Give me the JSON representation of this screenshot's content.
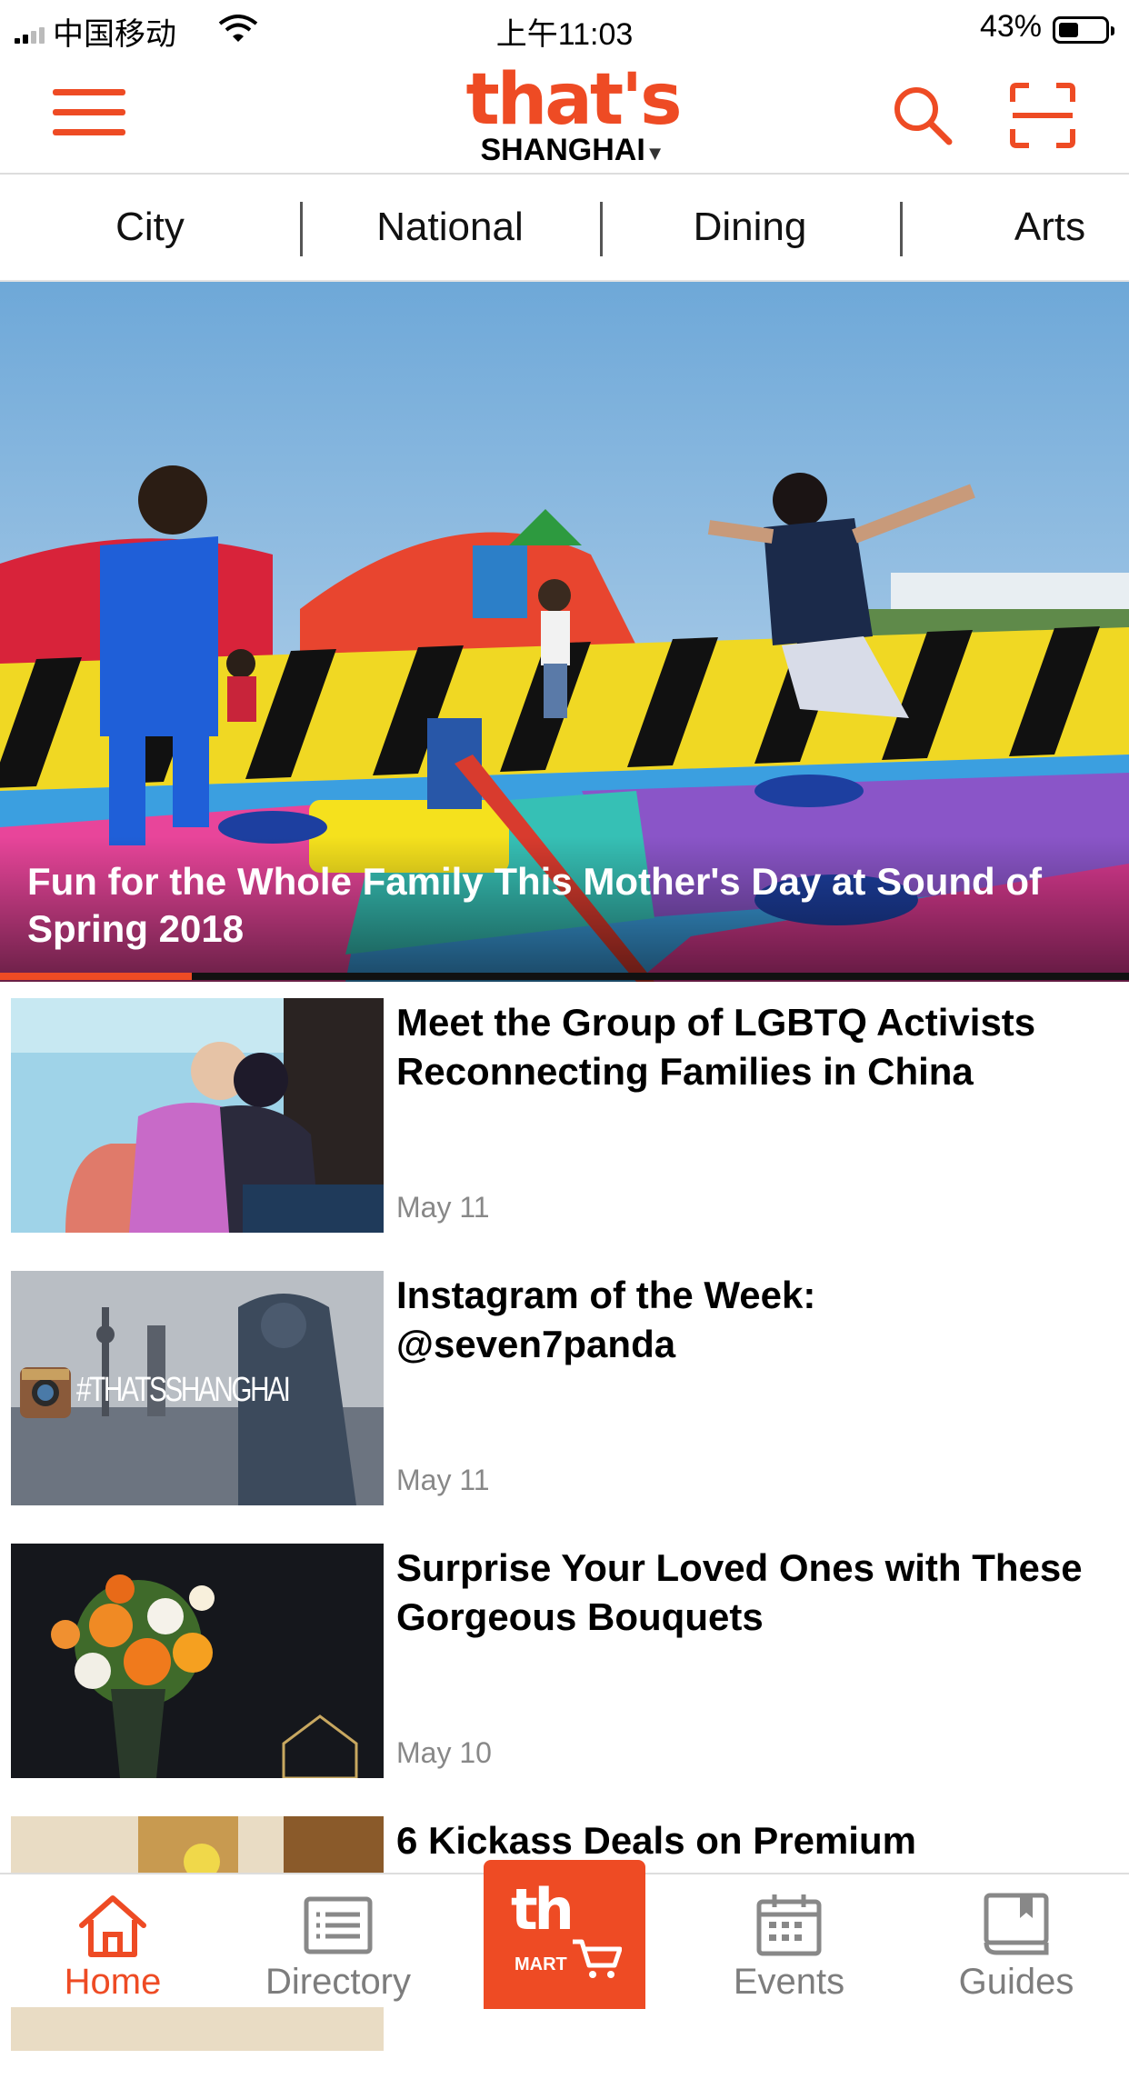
{
  "status_bar": {
    "carrier": "中国移动",
    "time": "上午11:03",
    "battery": "43%",
    "battery_level": 0.43
  },
  "header": {
    "brand": "that's",
    "city": "SHANGHAI"
  },
  "tabs": [
    "City",
    "National",
    "Dining",
    "Arts"
  ],
  "hero": {
    "title": "Fun for the Whole Family This Mother's Day at Sound of Spring 2018",
    "progress": 0.17
  },
  "articles": [
    {
      "title": "Meet the Group of LGBTQ Activists Reconnecting Families in China",
      "date": "May 11"
    },
    {
      "title": "Instagram of the Week: @seven7panda",
      "date": "May 11",
      "thumb_text": "#THATSSHANGHAI"
    },
    {
      "title": "Surprise Your Loved Ones with These Gorgeous Bouquets",
      "date": "May 10"
    },
    {
      "title": "6 Kickass Deals on Premium",
      "date": ""
    }
  ],
  "bottom_nav": {
    "home": "Home",
    "directory": "Directory",
    "mart": {
      "top": "th",
      "bottom": "MART"
    },
    "events": "Events",
    "guides": "Guides"
  },
  "colors": {
    "accent": "#ee4b24",
    "text": "#000000",
    "muted": "#888888"
  }
}
